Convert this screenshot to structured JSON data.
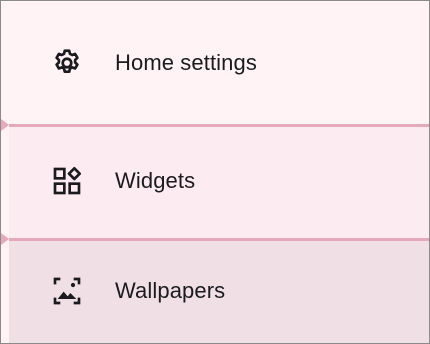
{
  "menu": {
    "items": [
      {
        "label": "Home settings",
        "icon": "gear-icon"
      },
      {
        "label": "Widgets",
        "icon": "widgets-icon"
      },
      {
        "label": "Wallpapers",
        "icon": "wallpaper-icon"
      }
    ]
  },
  "colors": {
    "text": "#1b1b1f",
    "divider": "#e6a9bc",
    "item_bg_1": "#fff3f6",
    "item_bg_2": "#fcebf0",
    "item_bg_3": "#f0e0e6"
  }
}
